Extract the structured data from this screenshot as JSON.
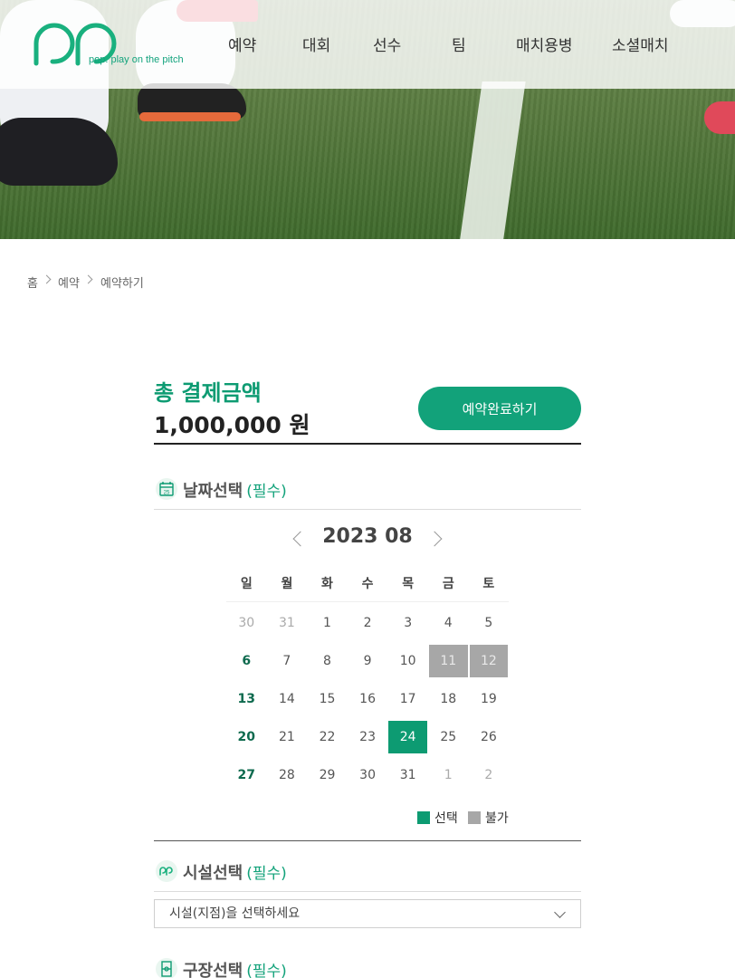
{
  "header": {
    "logo_tag": "pop. play on the pitch",
    "nav": [
      "예약",
      "대회",
      "선수",
      "팀",
      "매치용병",
      "소셜매치"
    ]
  },
  "breadcrumb": [
    "홈",
    "예약",
    "예약하기"
  ],
  "total": {
    "label": "총 결제금액",
    "amount": "1,000,000 원",
    "complete_button": "예약완료하기"
  },
  "date_section": {
    "title": "날짜선택",
    "required": "(필수)",
    "icon": "calendar-icon",
    "icon_day": "25"
  },
  "calendar": {
    "month_label": "2023 08",
    "weekdays": [
      "일",
      "월",
      "화",
      "수",
      "목",
      "금",
      "토"
    ],
    "weeks": [
      [
        "30",
        "31",
        "1",
        "2",
        "3",
        "4",
        "5"
      ],
      [
        "6",
        "7",
        "8",
        "9",
        "10",
        "11",
        "12"
      ],
      [
        "13",
        "14",
        "15",
        "16",
        "17",
        "18",
        "19"
      ],
      [
        "20",
        "21",
        "22",
        "23",
        "24",
        "25",
        "26"
      ],
      [
        "27",
        "28",
        "29",
        "30",
        "31",
        "1",
        "2"
      ]
    ],
    "selected": "24",
    "unavailable": [
      "11",
      "12"
    ],
    "colors": {
      "selected": "#0d9b72",
      "unavailable": "#a7a7a7",
      "sunday": "#0e6a4e"
    }
  },
  "legend": {
    "selected_label": "선택",
    "unavailable_label": "불가"
  },
  "facility_section": {
    "title": "시설선택",
    "required": "(필수)",
    "placeholder": "시설(지점)을 선택하세요"
  },
  "field_section": {
    "title": "구장선택",
    "required": "(필수)"
  },
  "brand_color": "#12a27a"
}
